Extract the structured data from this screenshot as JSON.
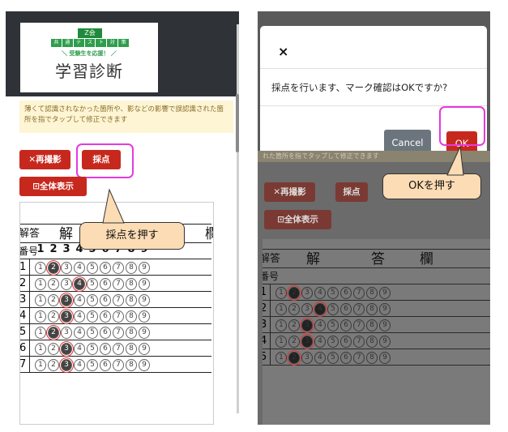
{
  "left": {
    "logo": {
      "badge": "Z会",
      "tagline": [
        "共",
        "通",
        "テ",
        "ス",
        "ト",
        "対",
        "策"
      ],
      "sub": "＼ 受験生を応援！ ／",
      "title": "学習診断"
    },
    "note": "薄くて認識されなかった箇所や、影などの影響で誤認識された箇所を指でタップして修正できます",
    "retake_label": "✕再撮影",
    "grade_label": "採点",
    "fullview_label": "⊡全体表示",
    "callout": "採点を押す",
    "sheet": {
      "header_answer": "解",
      "header_col": "答",
      "header_col2": "欄",
      "header_left_top": "解答",
      "header_left_bottom": "番号",
      "digits": [
        "1",
        "2",
        "3",
        "4",
        "5",
        "6",
        "7",
        "8",
        "9"
      ],
      "rows": [
        {
          "num": "1",
          "filled": 2
        },
        {
          "num": "2",
          "filled": 4
        },
        {
          "num": "3",
          "filled": 3
        },
        {
          "num": "4",
          "filled": 3
        },
        {
          "num": "5",
          "filled": 2
        },
        {
          "num": "6",
          "filled": 3
        },
        {
          "num": "7",
          "filled": 3
        }
      ]
    }
  },
  "right": {
    "modal": {
      "close": "×",
      "message": "採点を行います、マーク確認はOKですか?",
      "cancel_label": "Cancel",
      "ok_label": "OK"
    },
    "under_note": "れた箇所を指でタップして修正できます",
    "retake_label": "✕再撮影",
    "grade_label": "採点",
    "fullview_label": "⊡全体表示",
    "callout": "OKを押す",
    "rows": [
      {
        "num": "1",
        "filled": 2
      },
      {
        "num": "2",
        "filled": 4
      },
      {
        "num": "3",
        "filled": 3
      },
      {
        "num": "4",
        "filled": 3
      },
      {
        "num": "5",
        "filled": 2
      }
    ]
  },
  "colors": {
    "accent_red": "#c7281d",
    "highlight_magenta": "#e43ae0",
    "callout_bg": "#fcdcb4",
    "note_bg": "#fdf5d4",
    "logo_green": "#1f8a3b"
  }
}
